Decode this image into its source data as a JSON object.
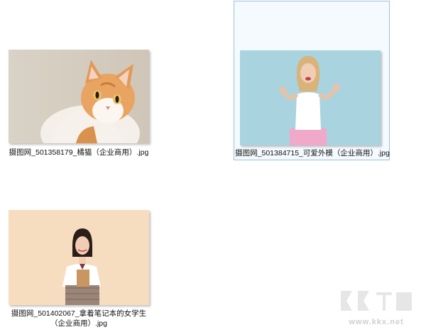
{
  "files": [
    {
      "name": "摄图网_501358179_橘猫（企业商用）.jpg",
      "thumb_icon": "orange-cat-photo",
      "selected": false
    },
    {
      "name": "摄图网_501384715_可爱外模（企业商用）.jpg",
      "thumb_icon": "woman-blue-background-photo",
      "selected": true
    },
    {
      "name": "摄图网_501402067_拿着笔记本的女学生（企业商用）.jpg",
      "thumb_icon": "schoolgirl-notebook-photo",
      "selected": false
    }
  ],
  "watermark": {
    "logo_text": "KK下载",
    "site": "www.kkx.net"
  },
  "colors": {
    "selection_border": "#99c0e8",
    "background": "#ffffff"
  }
}
